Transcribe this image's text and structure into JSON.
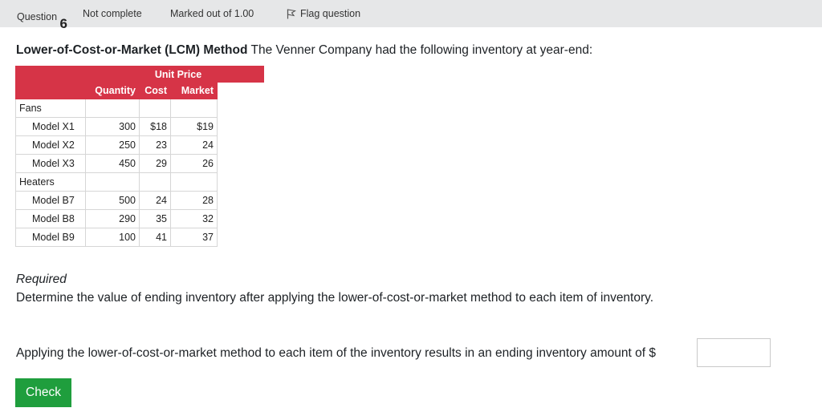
{
  "header": {
    "question_label": "Question",
    "question_number": "6",
    "status": "Not complete",
    "marks": "Marked out of 1.00",
    "flag_label": "Flag question"
  },
  "question": {
    "title_bold": "Lower-of-Cost-or-Market (LCM) Method",
    "title_rest": " The Venner Company had the following inventory at year-end:",
    "table": {
      "unit_price_header": "Unit Price",
      "col_quantity": "Quantity",
      "col_cost": "Cost",
      "col_market": "Market",
      "groups": [
        {
          "name": "Fans",
          "rows": [
            {
              "model": "Model X1",
              "quantity": "300",
              "cost": "$18",
              "market": "$19"
            },
            {
              "model": "Model X2",
              "quantity": "250",
              "cost": "23",
              "market": "24"
            },
            {
              "model": "Model X3",
              "quantity": "450",
              "cost": "29",
              "market": "26"
            }
          ]
        },
        {
          "name": "Heaters",
          "rows": [
            {
              "model": "Model B7",
              "quantity": "500",
              "cost": "24",
              "market": "28"
            },
            {
              "model": "Model B8",
              "quantity": "290",
              "cost": "35",
              "market": "32"
            },
            {
              "model": "Model B9",
              "quantity": "100",
              "cost": "41",
              "market": "37"
            }
          ]
        }
      ]
    },
    "required_label": "Required",
    "instruction": "Determine the value of ending inventory after applying the lower-of-cost-or-market method to each item of inventory.",
    "answer_prompt": "Applying the lower-of-cost-or-market method to each item of the inventory results in an ending inventory amount of $",
    "answer_value": ""
  },
  "actions": {
    "check_label": "Check"
  },
  "colors": {
    "table_header": "#d63447",
    "check_button": "#1f9e3d",
    "top_bar": "#e6e7e8"
  }
}
